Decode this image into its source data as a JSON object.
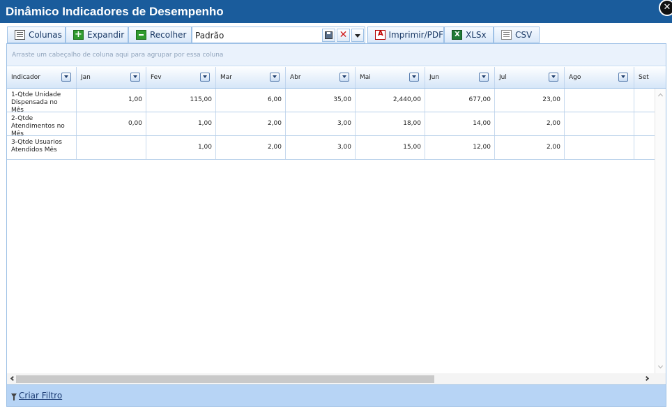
{
  "window": {
    "title": "Dinâmico Indicadores de Desempenho",
    "close_glyph": "✕"
  },
  "toolbar": {
    "columns_label": "Colunas",
    "expand_label": "Expandir",
    "collapse_label": "Recolher",
    "layout_value": "Padrão",
    "delete_glyph": "✕",
    "print_pdf_label": "Imprimir/PDF",
    "xlsx_label": "XLSx",
    "csv_label": "CSV"
  },
  "grid": {
    "group_panel_text": "Arraste um cabeçalho de coluna aqui para agrupar por essa coluna",
    "columns": [
      "Indicador",
      "Jan",
      "Fev",
      "Mar",
      "Abr",
      "Mai",
      "Jun",
      "Jul",
      "Ago",
      "Set"
    ],
    "rows": [
      {
        "indicador": "1-Qtde Unidade Dispensada no Mês",
        "values": [
          "1,00",
          "115,00",
          "6,00",
          "35,00",
          "2,440,00",
          "677,00",
          "23,00",
          "",
          ""
        ]
      },
      {
        "indicador": "2-Qtde Atendimentos no Mês",
        "values": [
          "0,00",
          "1,00",
          "2,00",
          "3,00",
          "18,00",
          "14,00",
          "2,00",
          "",
          ""
        ]
      },
      {
        "indicador": "3-Qtde Usuarios Atendidos Mês",
        "values": [
          "",
          "1,00",
          "2,00",
          "3,00",
          "15,00",
          "12,00",
          "2,00",
          "",
          ""
        ]
      }
    ]
  },
  "footer": {
    "create_filter_label": "Criar Filtro"
  },
  "colors": {
    "titlebar": "#1a5c9c",
    "footer": "#b7d4f5",
    "header_border": "#9ec1e6"
  }
}
